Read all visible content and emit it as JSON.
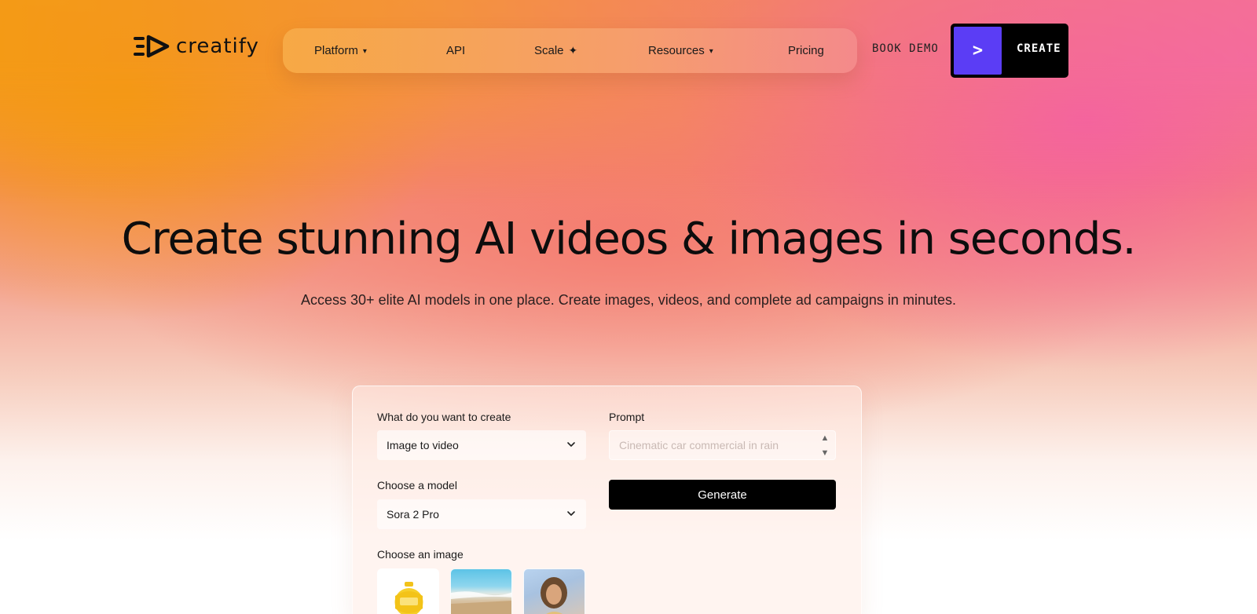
{
  "brand": {
    "name": "creatify"
  },
  "nav": {
    "items": [
      {
        "label": "Platform",
        "has_caret": true
      },
      {
        "label": "API"
      },
      {
        "label": "Scale",
        "icon": "sparkle-icon"
      },
      {
        "label": "Resources",
        "has_caret": true
      },
      {
        "label": "Pricing"
      }
    ],
    "caret_glyph": "▾",
    "sparkle_glyph": "✦",
    "book_demo": "BOOK DEMO",
    "create_label": "CREATE",
    "create_arrow": ">"
  },
  "hero": {
    "title": "Create stunning AI videos & images in seconds.",
    "subtitle": "Access 30+ elite AI models in one place. Create images, videos, and complete ad campaigns in minutes."
  },
  "form": {
    "create_type_label": "What do you want to create",
    "create_type_value": "Image to video",
    "model_label": "Choose a model",
    "model_value": "Sora 2 Pro",
    "image_label": "Choose an image",
    "prompt_label": "Prompt",
    "prompt_placeholder": "Cinematic car commercial in rain",
    "generate_label": "Generate",
    "images": [
      "product-bottle-image",
      "beach-image",
      "woman-portrait-image"
    ]
  },
  "colors": {
    "accent": "#5b3df5",
    "primary_button": "#000000",
    "gradient_orange": "#f59a0c",
    "gradient_pink": "#f467a8"
  }
}
